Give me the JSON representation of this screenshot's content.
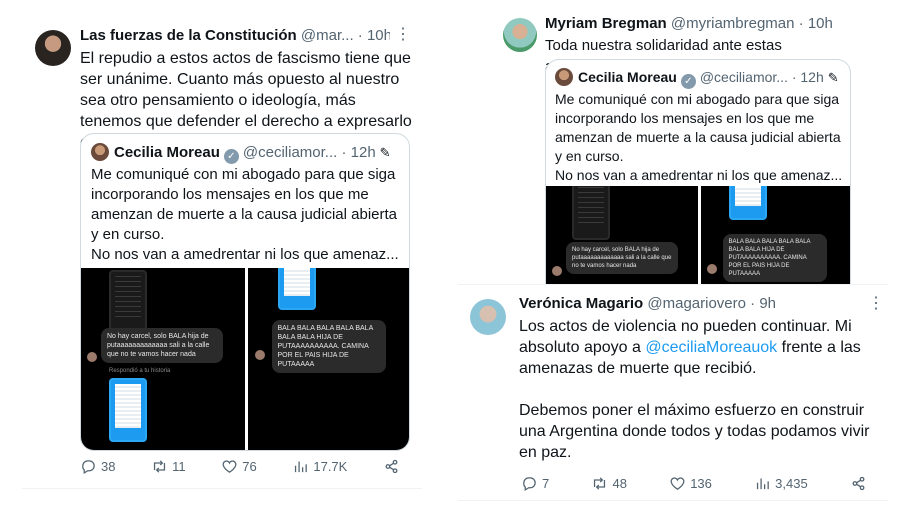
{
  "tweet1": {
    "name": "Las fuerzas de la Constitución",
    "handle": "@mar...",
    "time": "· 10h",
    "text": "El repudio a estos actos de fascismo tiene que ser unánime. Cuanto más opuesto al nuestro sea otro pensamiento o ideología, más tenemos que defender el derecho a expresarlo en libertad",
    "quote": {
      "name": "Cecilia Moreau",
      "handle": "@ceciliamor...",
      "time": "· 12h",
      "text_line1": "Me comuniqué con mi abogado para que siga incorporando los mensajes en los que me amenzan de muerte a la causa judicial abierta y en curso.",
      "text_line2": "No nos van a amedrentar ni los que amenaz...",
      "media_left": {
        "bubble": "No hay carcel,  solo BALA hija de putaaaaaaaaaaaaa sali a la calle que no te vamos hacer nada",
        "caption": "Respondió a tu historia"
      },
      "media_right": {
        "bubble": "BALA BALA BALA BALA BALA BALA BALA HIJA DE PUTAAAAAAAAAA. CAMINA POR EL PAIS HIJA DE PUTAAAAA"
      }
    },
    "actions": {
      "replies": "38",
      "retweets": "11",
      "likes": "76",
      "views": "17.7K"
    }
  },
  "tweet2": {
    "name": "Myriam Bregman",
    "handle": "@myriambregman",
    "time": "· 10h",
    "text": "Toda nuestra solidaridad ante estas amenazas.",
    "quote": {
      "name": "Cecilia Moreau",
      "handle": "@ceciliamor...",
      "time": "· 12h",
      "text_line1": "Me comuniqué con mi abogado para que siga incorporando los mensajes en los que me amenzan de muerte a la causa judicial abierta y en curso.",
      "text_line2": "No nos van a amedrentar ni los que amenaz...",
      "media_left": {
        "bubble": "No hay carcel,  solo BALA hija de putaaaaaaaaaaaaa sali a la calle que no te vamos hacer nada"
      },
      "media_right": {
        "bubble": "BALA BALA BALA BALA BALA BALA BALA HIJA DE PUTAAAAAAAAAA. CAMINA POR EL PAIS HIJA DE PUTAAAAA"
      }
    }
  },
  "tweet3": {
    "name": "Verónica Magario",
    "handle": "@magariovero",
    "time": "· 9h",
    "text_pre": "Los actos de violencia no pueden continuar. Mi absoluto apoyo a ",
    "mention": "@ceciliaMoreauok",
    "text_post": " frente a las amenazas de muerte que recibió.",
    "text_para2": "Debemos poner el máximo esfuerzo en construir una Argentina donde todos y todas podamos vivir en paz.",
    "actions": {
      "replies": "7",
      "retweets": "48",
      "likes": "136",
      "views": "3,435"
    }
  },
  "icons": {
    "more": "more-dots-icon",
    "reply": "reply-icon",
    "retweet": "retweet-icon",
    "like": "heart-icon",
    "views": "views-icon",
    "share": "share-icon",
    "verified": "verified-badge-icon",
    "edited": "pencil-icon"
  },
  "colors": {
    "link": "#1d9bf0",
    "muted": "#536471",
    "border": "#cfd9de"
  }
}
